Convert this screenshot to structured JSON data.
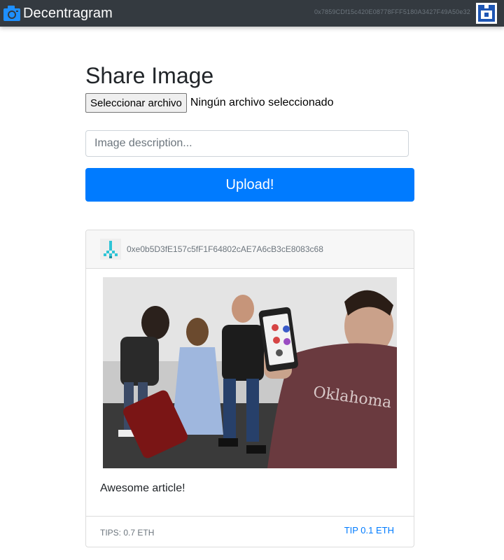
{
  "navbar": {
    "brand": "Decentragram",
    "brand_icon": "camera-icon",
    "account_address": "0x7859CDf15c420E08778FFF5180A3427F49A50e32",
    "account_avatar": "identicon-avatar"
  },
  "upload_form": {
    "title": "Share Image",
    "file_button_label": "Seleccionar archivo",
    "file_status": "Ningún archivo seleccionado",
    "description_placeholder": "Image description...",
    "upload_label": "Upload!"
  },
  "posts": [
    {
      "author": "0xe0b5D3fE157c5fF1F64802cAE7A6cB3cE8083c68",
      "author_avatar": "identicon-avatar",
      "description": "Awesome article!",
      "tips": "TIPS: 0.7 ETH",
      "tip_label": "TIP 0.1 ETH"
    }
  ],
  "colors": {
    "navbar_bg": "#343a40",
    "primary": "#007bff",
    "muted": "#6c757d"
  }
}
